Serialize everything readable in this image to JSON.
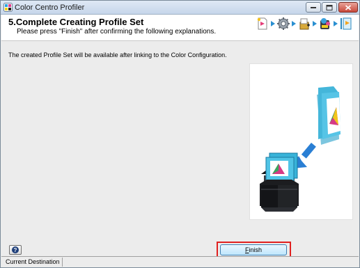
{
  "window": {
    "title": "Color Centro Profiler"
  },
  "header": {
    "step_title": "5.Complete Creating Profile Set",
    "step_subtitle": "Please press \"Finish\" after confirming the following explanations."
  },
  "step_icons": [
    "wizard-start-icon",
    "gear-icon",
    "package-icon",
    "profile-link-icon",
    "complete-icon"
  ],
  "main": {
    "info_text": "The created Profile Set will be available after linking to the Color Configuration."
  },
  "footer": {
    "finish_first": "F",
    "finish_rest": "inish",
    "finish_highlight_color": "#e0201f"
  },
  "status": {
    "current_destination": "Current Destination"
  }
}
